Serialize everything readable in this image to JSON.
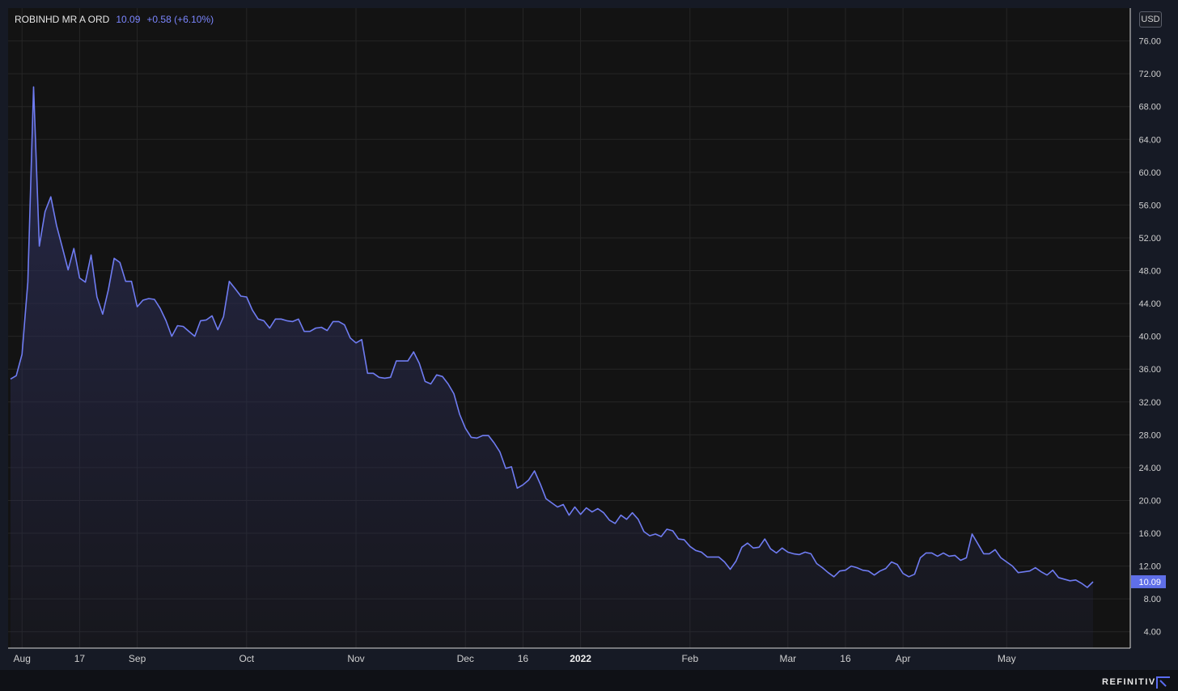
{
  "header": {
    "symbol": "ROBINHD MR A ORD",
    "last": "10.09",
    "change": "+0.58 (+6.10%)"
  },
  "currency": "USD",
  "brand": "REFINITIV",
  "colors": {
    "line": "#6f7cf2",
    "fill_top": "#2a2c52",
    "background": "#161a25",
    "plot_bg": "#131313",
    "grid": "#262626",
    "price_tag": "#5f6fe8"
  },
  "chart_data": {
    "type": "area",
    "ylim": [
      2,
      80
    ],
    "y_ticks": [
      "4.00",
      "8.00",
      "12.00",
      "16.00",
      "20.00",
      "24.00",
      "28.00",
      "32.00",
      "36.00",
      "40.00",
      "44.00",
      "48.00",
      "52.00",
      "56.00",
      "60.00",
      "64.00",
      "68.00",
      "72.00",
      "76.00"
    ],
    "last_price_label": "10.09",
    "x_ticks": [
      {
        "label": "Aug",
        "i": 2,
        "bold": false
      },
      {
        "label": "17",
        "i": 12,
        "bold": false
      },
      {
        "label": "Sep",
        "i": 22,
        "bold": false
      },
      {
        "label": "Oct",
        "i": 41,
        "bold": false
      },
      {
        "label": "Nov",
        "i": 60,
        "bold": false
      },
      {
        "label": "Dec",
        "i": 79,
        "bold": false
      },
      {
        "label": "16",
        "i": 89,
        "bold": false
      },
      {
        "label": "2022",
        "i": 99,
        "bold": true
      },
      {
        "label": "Feb",
        "i": 118,
        "bold": false
      },
      {
        "label": "Mar",
        "i": 135,
        "bold": false
      },
      {
        "label": "16",
        "i": 145,
        "bold": false
      },
      {
        "label": "Apr",
        "i": 155,
        "bold": false
      },
      {
        "label": "May",
        "i": 173,
        "bold": false
      }
    ],
    "values": [
      34.8,
      35.2,
      37.8,
      46.6,
      70.4,
      51.0,
      55.2,
      57.0,
      53.5,
      50.8,
      48.1,
      50.7,
      47.1,
      46.6,
      49.9,
      44.8,
      42.7,
      45.7,
      49.5,
      49.0,
      46.7,
      46.7,
      43.6,
      44.4,
      44.6,
      44.5,
      43.4,
      41.9,
      40.0,
      41.3,
      41.2,
      40.6,
      40.0,
      41.9,
      42.0,
      42.5,
      40.8,
      42.4,
      46.7,
      45.8,
      44.9,
      44.8,
      43.2,
      42.1,
      41.9,
      41.0,
      42.1,
      42.1,
      41.9,
      41.8,
      42.1,
      40.6,
      40.6,
      41.0,
      41.1,
      40.7,
      41.8,
      41.8,
      41.4,
      39.8,
      39.2,
      39.6,
      35.5,
      35.5,
      35.0,
      34.9,
      35.0,
      37.0,
      37.0,
      37.0,
      38.1,
      36.7,
      34.5,
      34.2,
      35.3,
      35.1,
      34.2,
      33.0,
      30.5,
      28.8,
      27.7,
      27.6,
      27.9,
      27.9,
      27.0,
      25.9,
      23.9,
      24.1,
      21.5,
      21.9,
      22.5,
      23.6,
      22.0,
      20.2,
      19.7,
      19.2,
      19.5,
      18.2,
      19.2,
      18.3,
      19.1,
      18.6,
      19.0,
      18.5,
      17.6,
      17.2,
      18.2,
      17.7,
      18.5,
      17.7,
      16.2,
      15.7,
      15.9,
      15.6,
      16.5,
      16.3,
      15.3,
      15.2,
      14.4,
      13.9,
      13.7,
      13.1,
      13.1,
      13.1,
      12.5,
      11.6,
      12.6,
      14.3,
      14.8,
      14.2,
      14.3,
      15.3,
      14.1,
      13.6,
      14.2,
      13.7,
      13.5,
      13.4,
      13.7,
      13.5,
      12.3,
      11.8,
      11.2,
      10.7,
      11.4,
      11.5,
      12.0,
      11.8,
      11.5,
      11.4,
      10.9,
      11.4,
      11.7,
      12.5,
      12.2,
      11.1,
      10.7,
      11.0,
      13.0,
      13.6,
      13.6,
      13.2,
      13.6,
      13.2,
      13.3,
      12.7,
      13.0,
      15.9,
      14.7,
      13.5,
      13.5,
      14.0,
      13.0,
      12.5,
      12.0,
      11.2,
      11.3,
      11.4,
      11.8,
      11.3,
      10.9,
      11.5,
      10.6,
      10.4,
      10.2,
      10.3,
      9.9,
      9.4,
      10.09
    ]
  }
}
